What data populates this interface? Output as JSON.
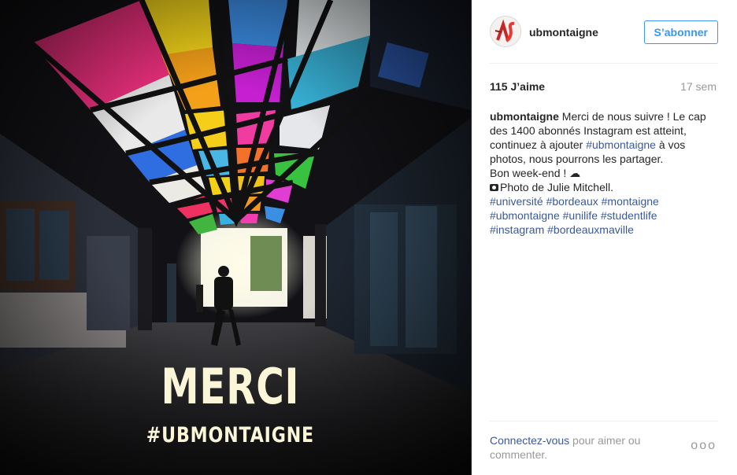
{
  "post": {
    "username": "ubmontaigne",
    "follow_label": "S’abonner",
    "likes": "115 J’aime",
    "age": "17 sem",
    "caption_lines": [
      [
        "",
        "Merci de nous suivre ! Le cap"
      ],
      [
        "des 1400 abonnés Instagram est atteint,"
      ],
      [
        "continuez à ajouter ",
        "#ubmontaigne",
        " à vos"
      ],
      [
        "photos, nous pourrons les partager."
      ],
      [
        "Bon week-end ! ☁"
      ],
      [
        "Photo de Julie Mitchell."
      ],
      [
        "#université #bordeaux #montaigne"
      ],
      [
        "#ubmontaigne #unilife #studentlife"
      ],
      [
        "#instagram #bordeauxmaville"
      ]
    ],
    "login_link": "Connectez-vous",
    "login_text": " pour aimer ou commenter.",
    "more_label": "ooo"
  },
  "photo": {
    "overlay_title": "MERCI",
    "overlay_tag": "#UBMONTAIGNE"
  },
  "colors": {
    "accent_blue": "#3897f0",
    "link_blue": "#3b5998",
    "muted": "#999999"
  },
  "icons": [
    "avatar-logo",
    "camera-icon",
    "more-options-icon"
  ]
}
